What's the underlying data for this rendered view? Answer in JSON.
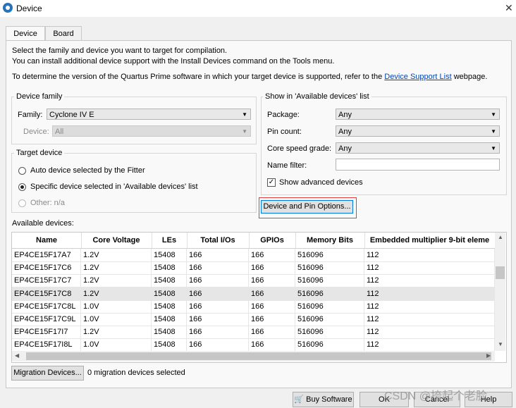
{
  "window": {
    "title": "Device",
    "close_glyph": "✕"
  },
  "tabs": [
    {
      "label": "Device"
    },
    {
      "label": "Board"
    }
  ],
  "intro": {
    "line1": "Select the family and device you want to target for compilation.",
    "line2": "You can install additional device support with the Install Devices command on the Tools menu.",
    "line3_pre": "To determine the version of the Quartus Prime software in which your target device is supported, refer to the",
    "line3_link": "Device Support List",
    "line3_post": "webpage."
  },
  "device_family": {
    "legend": "Device family",
    "family_label": "Family:",
    "family_value": "Cyclone IV E",
    "device_label": "Device:",
    "device_value": "All"
  },
  "target_device": {
    "legend": "Target device",
    "auto": "Auto device selected by the Fitter",
    "specific": "Specific device selected in 'Available devices' list",
    "other_label": "Other:",
    "other_value": "n/a",
    "selected": "specific"
  },
  "show_in": {
    "legend": "Show in 'Available devices' list",
    "package_label": "Package:",
    "package_value": "Any",
    "pincount_label": "Pin count:",
    "pincount_value": "Any",
    "speed_label": "Core speed grade:",
    "speed_value": "Any",
    "namefilter_label": "Name filter:",
    "namefilter_value": "",
    "show_advanced_label": "Show advanced devices",
    "show_advanced_checked": true
  },
  "device_pin_options_button": "Device and Pin Options...",
  "available": {
    "label": "Available devices:",
    "columns": [
      "Name",
      "Core Voltage",
      "LEs",
      "Total I/Os",
      "GPIOs",
      "Memory Bits",
      "Embedded multiplier 9-bit eleme"
    ],
    "rows": [
      [
        "EP4CE15F17A7",
        "1.2V",
        "15408",
        "166",
        "166",
        "516096",
        "112"
      ],
      [
        "EP4CE15F17C6",
        "1.2V",
        "15408",
        "166",
        "166",
        "516096",
        "112"
      ],
      [
        "EP4CE15F17C7",
        "1.2V",
        "15408",
        "166",
        "166",
        "516096",
        "112"
      ],
      [
        "EP4CE15F17C8",
        "1.2V",
        "15408",
        "166",
        "166",
        "516096",
        "112"
      ],
      [
        "EP4CE15F17C8L",
        "1.0V",
        "15408",
        "166",
        "166",
        "516096",
        "112"
      ],
      [
        "EP4CE15F17C9L",
        "1.0V",
        "15408",
        "166",
        "166",
        "516096",
        "112"
      ],
      [
        "EP4CE15F17I7",
        "1.2V",
        "15408",
        "166",
        "166",
        "516096",
        "112"
      ],
      [
        "EP4CE15F17I8L",
        "1.0V",
        "15408",
        "166",
        "166",
        "516096",
        "112"
      ]
    ],
    "selected_row": 3
  },
  "migration": {
    "button": "Migration Devices...",
    "status": "0 migration devices selected"
  },
  "bottom_buttons": {
    "buy": "Buy Software",
    "ok": "OK",
    "cancel": "Cancel",
    "help": "Help"
  },
  "watermark": "CSDN @挎起个老脸"
}
